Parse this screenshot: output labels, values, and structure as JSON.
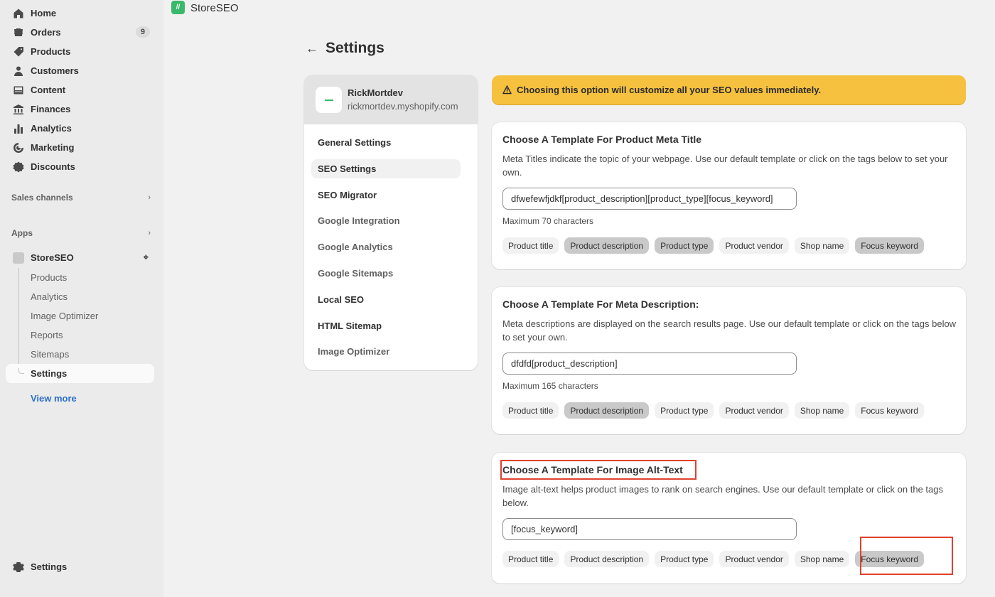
{
  "sidebar": {
    "nav": [
      {
        "label": "Home",
        "icon": "home-icon"
      },
      {
        "label": "Orders",
        "icon": "orders-icon",
        "badge": "9"
      },
      {
        "label": "Products",
        "icon": "tag-icon"
      },
      {
        "label": "Customers",
        "icon": "person-icon"
      },
      {
        "label": "Content",
        "icon": "content-icon"
      },
      {
        "label": "Finances",
        "icon": "bank-icon"
      },
      {
        "label": "Analytics",
        "icon": "bar-chart-icon"
      },
      {
        "label": "Marketing",
        "icon": "target-icon"
      },
      {
        "label": "Discounts",
        "icon": "discount-icon"
      }
    ],
    "sales_channels": "Sales channels",
    "apps": "Apps",
    "app_name": "StoreSEO",
    "app_sub": [
      "Products",
      "Analytics",
      "Image Optimizer",
      "Reports",
      "Sitemaps"
    ],
    "app_active": "Settings",
    "view_more": "View more",
    "bottom_settings": "Settings"
  },
  "topbar": {
    "title": "StoreSEO",
    "logo_text": "//"
  },
  "page": {
    "title": "Settings"
  },
  "store": {
    "name": "RickMortdev",
    "url": "rickmortdev.myshopify.com"
  },
  "menu": {
    "items": [
      {
        "label": "General Settings"
      },
      {
        "label": "SEO Settings"
      },
      {
        "label": "SEO Migrator"
      },
      {
        "label": "Google Integration"
      },
      {
        "label": "Google Analytics"
      },
      {
        "label": "Google Sitemaps"
      },
      {
        "label": "Local SEO"
      },
      {
        "label": "HTML Sitemap"
      },
      {
        "label": "Image Optimizer"
      }
    ],
    "active": "SEO Settings"
  },
  "banner": {
    "text": "Choosing this option will customize all your SEO values immediately."
  },
  "tag_labels": [
    "Product title",
    "Product description",
    "Product type",
    "Product vendor",
    "Shop name",
    "Focus keyword"
  ],
  "cards": [
    {
      "title": "Choose A Template For Product Meta Title",
      "description": "Meta Titles indicate the topic of your webpage. Use our default template or click on the tags below to set your own.",
      "value": "dfwefewfjdkf[product_description][product_type][focus_keyword]",
      "hint": "Maximum 70 characters",
      "selected_tags": [
        "Product description",
        "Product type",
        "Focus keyword"
      ]
    },
    {
      "title": "Choose A Template For Meta Description:",
      "description": "Meta descriptions are displayed on the search results page. Use our default template or click on the tags below to set your own.",
      "value": "dfdfd[product_description]",
      "hint": "Maximum 165 characters",
      "selected_tags": [
        "Product description"
      ]
    },
    {
      "title": "Choose A Template For Image Alt-Text",
      "description": "Image alt-text helps product images to rank on search engines. Use our default template or click on the tags below.",
      "value": "[focus_keyword]",
      "hint": "",
      "selected_tags": [
        "Focus keyword"
      ]
    }
  ],
  "colors": {
    "accent_green": "#39b96b",
    "banner": "#f6c13f",
    "highlight": "#e0412e",
    "link": "#2c6ecb"
  }
}
